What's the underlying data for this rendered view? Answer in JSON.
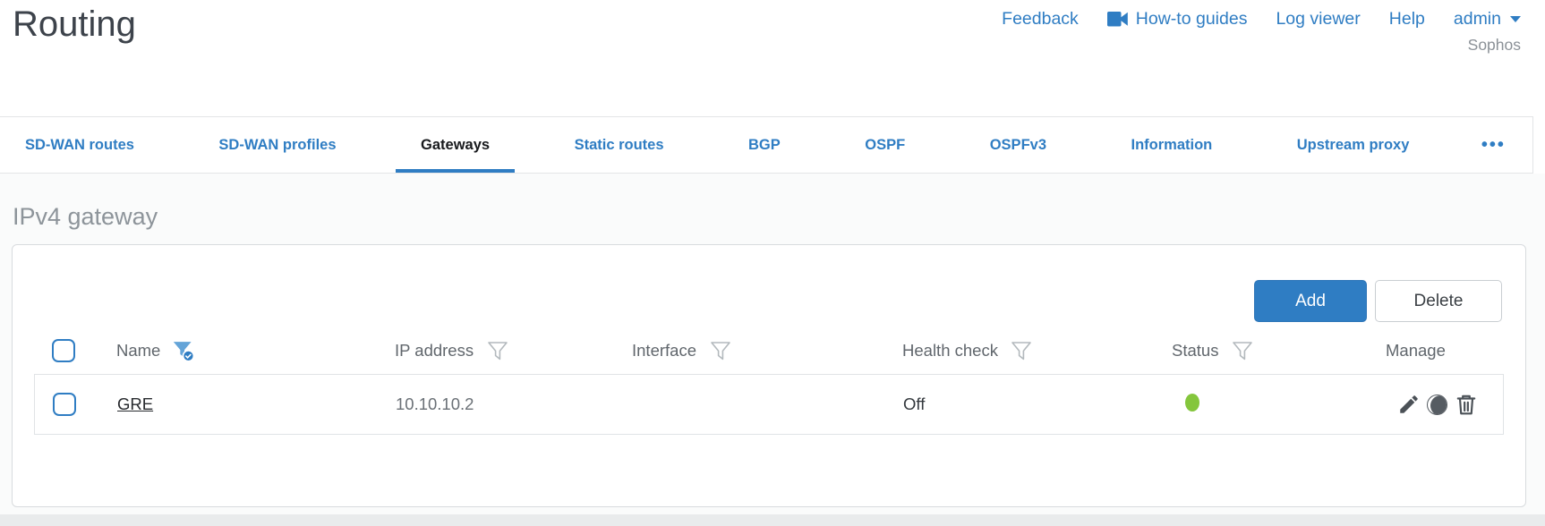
{
  "page": {
    "title": "Routing"
  },
  "header": {
    "links": [
      {
        "label": "Feedback"
      },
      {
        "label": "How-to guides",
        "icon": "video-camera-icon"
      },
      {
        "label": "Log viewer"
      },
      {
        "label": "Help"
      }
    ],
    "user_menu": {
      "label": "admin"
    },
    "brand": "Sophos"
  },
  "tabs": {
    "items": [
      {
        "label": "SD-WAN routes",
        "active": false
      },
      {
        "label": "SD-WAN profiles",
        "active": false
      },
      {
        "label": "Gateways",
        "active": true
      },
      {
        "label": "Static routes",
        "active": false
      },
      {
        "label": "BGP",
        "active": false
      },
      {
        "label": "OSPF",
        "active": false
      },
      {
        "label": "OSPFv3",
        "active": false
      },
      {
        "label": "Information",
        "active": false
      },
      {
        "label": "Upstream proxy",
        "active": false
      }
    ],
    "overflow_label": "•••"
  },
  "section": {
    "title": "IPv4 gateway"
  },
  "toolbar": {
    "add_label": "Add",
    "delete_label": "Delete"
  },
  "table": {
    "columns": [
      {
        "label": "Name",
        "filter": "active"
      },
      {
        "label": "IP address",
        "filter": "inactive"
      },
      {
        "label": "Interface",
        "filter": "inactive"
      },
      {
        "label": "Health check",
        "filter": "inactive"
      },
      {
        "label": "Status",
        "filter": "inactive"
      },
      {
        "label": "Manage",
        "filter": "none"
      }
    ],
    "rows": [
      {
        "name": "GRE",
        "ip_address": "10.10.10.2",
        "interface": "",
        "health_check": "Off",
        "status": "up"
      }
    ]
  },
  "icons": {
    "manage": [
      "edit-pencil-icon",
      "view-icon",
      "delete-trash-icon"
    ],
    "name_filter": "filter-funnel-checked-icon",
    "column_filter": "filter-funnel-icon"
  },
  "colors": {
    "accent_blue": "#2f7dc3",
    "status_green": "#84c63c"
  }
}
